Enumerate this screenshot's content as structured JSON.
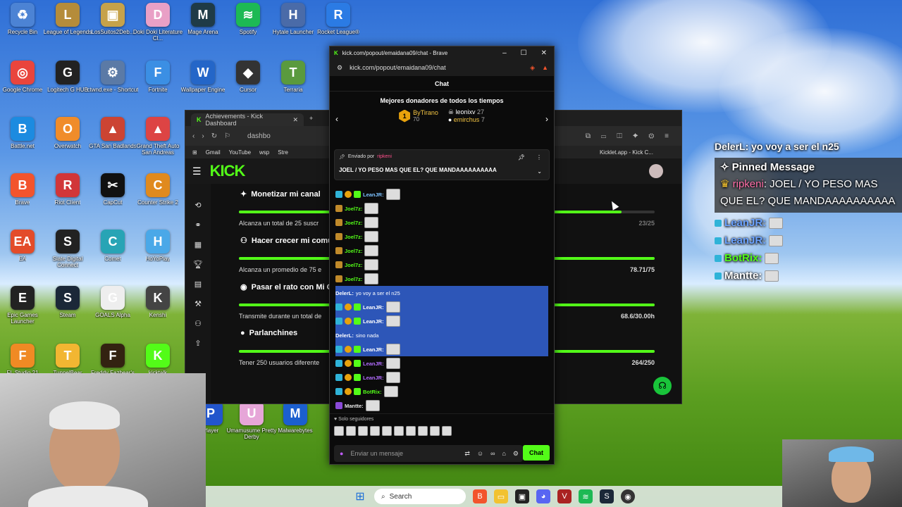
{
  "desktop_icons": [
    {
      "label": "Recycle Bin",
      "color": "#4c83d4",
      "glyph": "♻"
    },
    {
      "label": "League of Legends",
      "color": "#b58c3a",
      "glyph": "L"
    },
    {
      "label": "LosSuitos2Deb...",
      "color": "#c6a24a",
      "glyph": "▣"
    },
    {
      "label": "Doki Doki Literature Cl...",
      "color": "#e9a0c6",
      "glyph": "D"
    },
    {
      "label": "Mage Arena",
      "color": "#1f3b47",
      "glyph": "M"
    },
    {
      "label": "Spotify",
      "color": "#1db954",
      "glyph": "≋"
    },
    {
      "label": "Hytale Launcher",
      "color": "#4a6ba8",
      "glyph": "H"
    },
    {
      "label": "Rocket League®",
      "color": "#2b7be4",
      "glyph": "R"
    },
    {
      "label": "Google Chrome",
      "color": "#e9453d",
      "glyph": "◎"
    },
    {
      "label": "Logitech G HUB",
      "color": "#222222",
      "glyph": "G"
    },
    {
      "label": "ctwnd.exe - Shortcut",
      "color": "#5b7aa6",
      "glyph": "⚙"
    },
    {
      "label": "Fortnite",
      "color": "#3b8fe4",
      "glyph": "F"
    },
    {
      "label": "Wallpaper Engine",
      "color": "#2466c8",
      "glyph": "W"
    },
    {
      "label": "Cursor",
      "color": "#333333",
      "glyph": "◆"
    },
    {
      "label": "Terraria",
      "color": "#5a9a3e",
      "glyph": "T"
    },
    {
      "label": "Battle.net",
      "color": "#1c8be0",
      "glyph": "B"
    },
    {
      "label": "Overwatch",
      "color": "#f08c2a",
      "glyph": "O"
    },
    {
      "label": "GTA San Badlands",
      "color": "#c43",
      "glyph": "▲"
    },
    {
      "label": "Grand Theft Auto San Andreas",
      "color": "#d44",
      "glyph": "▲"
    },
    {
      "label": "Brave",
      "color": "#f2542d",
      "glyph": "B"
    },
    {
      "label": "Riot Client",
      "color": "#d13639",
      "glyph": "R"
    },
    {
      "label": "CapCut",
      "color": "#111111",
      "glyph": "✂"
    },
    {
      "label": "Counter Strike 2",
      "color": "#e08a1e",
      "glyph": "C"
    },
    {
      "label": "EA",
      "color": "#e34c2a",
      "glyph": "EA"
    },
    {
      "label": "Slate Digital Connect",
      "color": "#222222",
      "glyph": "S"
    },
    {
      "label": "Comet",
      "color": "#28a4b5",
      "glyph": "C"
    },
    {
      "label": "HoYoPlay",
      "color": "#4aa8e8",
      "glyph": "H"
    },
    {
      "label": "Epic Games Launcher",
      "color": "#222222",
      "glyph": "E"
    },
    {
      "label": "Steam",
      "color": "#1b2838",
      "glyph": "S"
    },
    {
      "label": "GOALS Alpha",
      "color": "#eeeeee",
      "glyph": "G"
    },
    {
      "label": "Kenshi",
      "color": "#444444",
      "glyph": "K"
    },
    {
      "label": "FL Studio 21",
      "color": "#f08a24",
      "glyph": "F"
    },
    {
      "label": "TunnelBear",
      "color": "#f2b632",
      "glyph": "T"
    },
    {
      "label": "Freddy Fazbear's",
      "color": "#332211",
      "glyph": "F"
    },
    {
      "label": "kicktalk",
      "color": "#53fc18",
      "glyph": "K"
    },
    {
      "label": "Player",
      "color": "#2255cc",
      "glyph": "P"
    },
    {
      "label": "Umamusume Pretty Derby",
      "color": "#e6a6d8",
      "glyph": "U"
    },
    {
      "label": "Malwarebytes",
      "color": "#1b5fcf",
      "glyph": "M"
    }
  ],
  "back_window": {
    "tab_title": "Achievements - Kick Dashboard",
    "address": "dashbo",
    "bookmarks": [
      "Gmail",
      "YouTube",
      "wsp",
      "Stre"
    ],
    "right_bookmark": "Kicklet.app - Kick C...",
    "logo": "KICK",
    "achievements": [
      {
        "title": "Monetizar mi canal",
        "desc": "Alcanza un total de 25 suscr",
        "value": "23/25",
        "progress": 0.92
      },
      {
        "title": "Hacer crecer mi comu",
        "desc": "Alcanza un promedio de 75 e",
        "value": "78.71/75",
        "progress": 1.0
      },
      {
        "title": "Pasar el rato con Mi C",
        "desc": "Transmite durante un total de",
        "value": "68.6/30.00h",
        "progress": 1.0
      },
      {
        "title": "Parlanchines",
        "desc": "Tener 250 usuarios diferente",
        "value": "264/250",
        "progress": 1.0
      }
    ]
  },
  "chat_window": {
    "title": "kick.com/popout/emaidana09/chat - Brave",
    "address": "kick.com/popout/emaidana09/chat",
    "header": "Chat",
    "donors_title": "Mejores donadores de todos los tiempos",
    "donor_rank": "1",
    "donor_top": {
      "name": "ByTirano",
      "amount": "70"
    },
    "donor_2": {
      "name": "leonixv",
      "amount": "27"
    },
    "donor_3": {
      "name": "emirchus",
      "amount": "7"
    },
    "pinned_by_label": "Enviado por",
    "pinned_by_user": "ripkeni",
    "pinned_message": "JOEL / YO PESO MAS QUE EL? QUE MANDAAAAAAAAAA",
    "messages": [
      {
        "user": "LeanJR:",
        "color": "#7cc1ff",
        "text": "",
        "emote": true,
        "sel": false
      },
      {
        "user": "Joel7z:",
        "color": "#53fc18",
        "text": "",
        "emote": true,
        "sel": false
      },
      {
        "user": "Joel7z:",
        "color": "#53fc18",
        "text": "",
        "emote": true,
        "sel": false
      },
      {
        "user": "Joel7z:",
        "color": "#53fc18",
        "text": "",
        "emote": true,
        "sel": false
      },
      {
        "user": "Joel7z:",
        "color": "#53fc18",
        "text": "",
        "emote": true,
        "sel": false
      },
      {
        "user": "Joel7z:",
        "color": "#53fc18",
        "text": "",
        "emote": true,
        "sel": false
      },
      {
        "user": "Joel7z:",
        "color": "#53fc18",
        "text": "",
        "emote": true,
        "sel": false
      },
      {
        "user": "DelerL:",
        "color": "#ffffff",
        "text": "yo voy a ser el n25",
        "emote": false,
        "sel": true
      },
      {
        "user": "LeanJR:",
        "color": "#ffffff",
        "text": "",
        "emote": true,
        "sel": true
      },
      {
        "user": "LeanJR:",
        "color": "#ffffff",
        "text": "",
        "emote": true,
        "sel": true
      },
      {
        "user": "DelerL:",
        "color": "#ffffff",
        "text": "sino nada",
        "emote": false,
        "sel": true
      },
      {
        "user": "LeanJR:",
        "color": "#ffffff",
        "text": "",
        "emote": true,
        "sel": true
      },
      {
        "user": "LeanJR:",
        "color": "#b26bff",
        "text": "",
        "emote": true,
        "sel": false
      },
      {
        "user": "LeanJR:",
        "color": "#b26bff",
        "text": "",
        "emote": true,
        "sel": false
      },
      {
        "user": "BotRix:",
        "color": "#53fc18",
        "text": "",
        "emote": true,
        "sel": false
      },
      {
        "user": "Mantte:",
        "color": "#e9e9e9",
        "text": "",
        "emote": true,
        "sel": false
      }
    ],
    "followers_only": "Solo seguidores",
    "input_placeholder": "Enviar un mensaje",
    "send_label": "Chat"
  },
  "overlay": {
    "line1": "DelerL: yo voy a ser el n25",
    "pinned_label": "Pinned Message",
    "pinned_user": "ripkeni",
    "pinned_text": ": JOEL / YO PESO MAS QUE EL? QUE MANDAAAAAAAAAA",
    "rows": [
      {
        "user": "LeanJR:",
        "color": "#6aa2ff"
      },
      {
        "user": "LeanJR:",
        "color": "#6aa2ff"
      },
      {
        "user": "BotRix:",
        "color": "#53fc18"
      },
      {
        "user": "Mantte:",
        "color": "#ffffff"
      }
    ]
  },
  "taskbar": {
    "search_label": "Search"
  }
}
